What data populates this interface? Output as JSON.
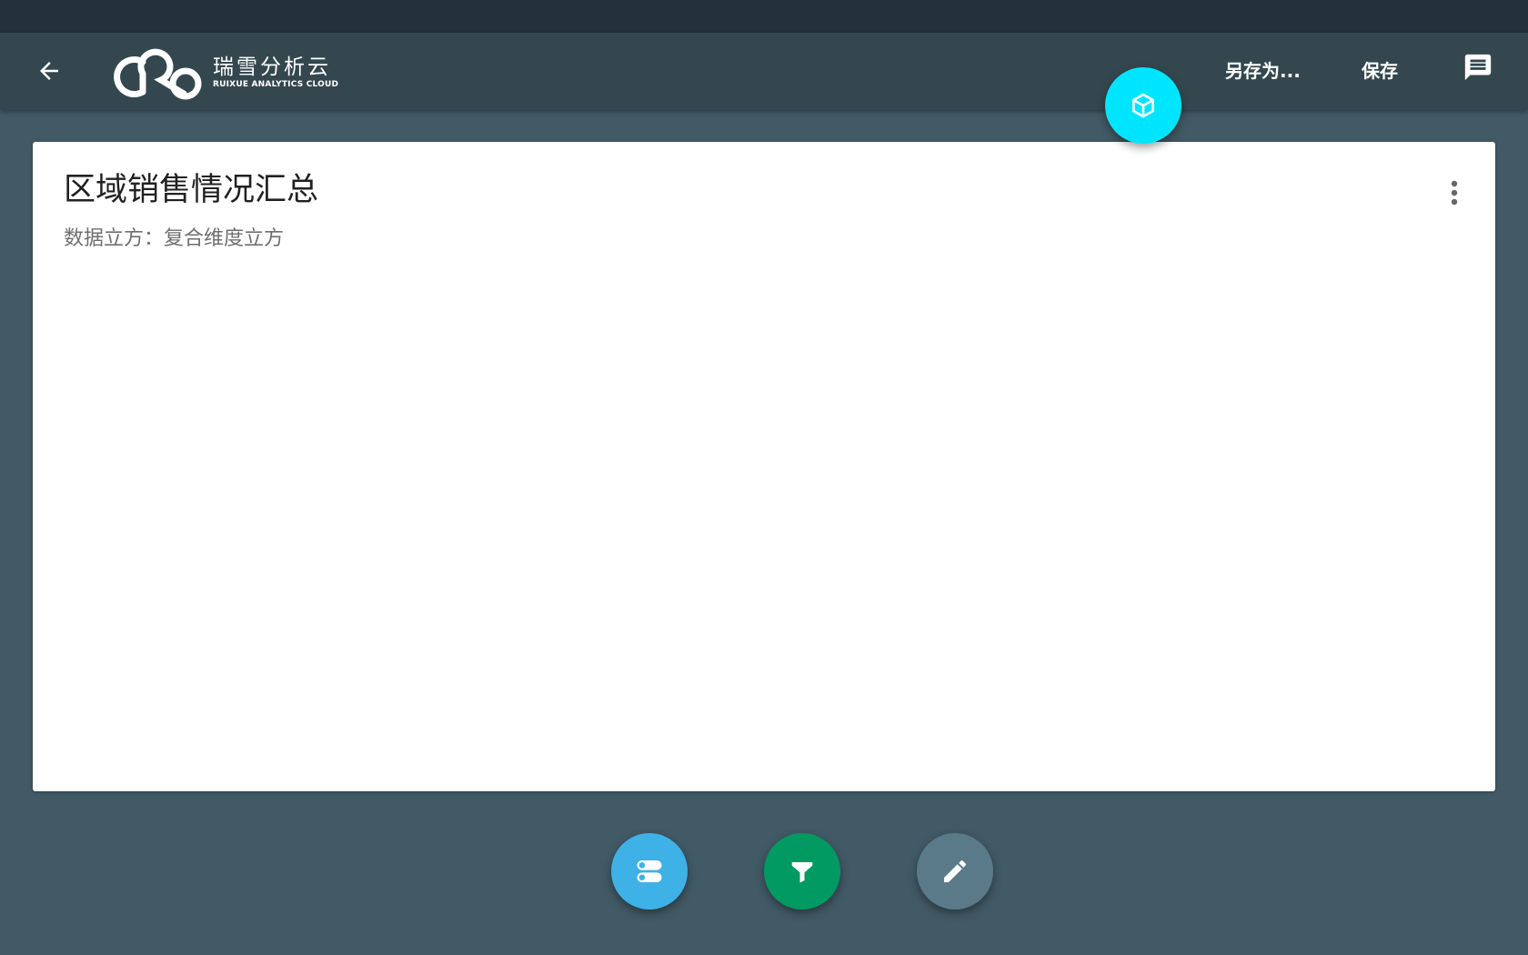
{
  "header": {
    "logo": {
      "name_cn": "瑞雪分析云",
      "name_en": "RUIXUE ANALYTICS CLOUD"
    },
    "save_as_label": "另存为...",
    "save_label": "保存"
  },
  "report": {
    "title": "区域销售情况汇总",
    "cube_prefix": "数据立方：",
    "cube_name": "复合维度立方"
  },
  "icons": {
    "back": "arrow-back-icon",
    "message": "message-icon",
    "more": "more-vert-icon",
    "cube": "cube-icon",
    "dimensions": "toggles-icon",
    "filter": "filter-icon",
    "edit": "pencil-icon"
  },
  "colors": {
    "status_bar": "#23313a",
    "app_bar": "#34474f",
    "background": "#425a66",
    "fab_cube": "#00e5ff",
    "fab_dimensions": "#3eb1e6",
    "fab_filter": "#009a62",
    "fab_edit": "#5a7a8a"
  }
}
